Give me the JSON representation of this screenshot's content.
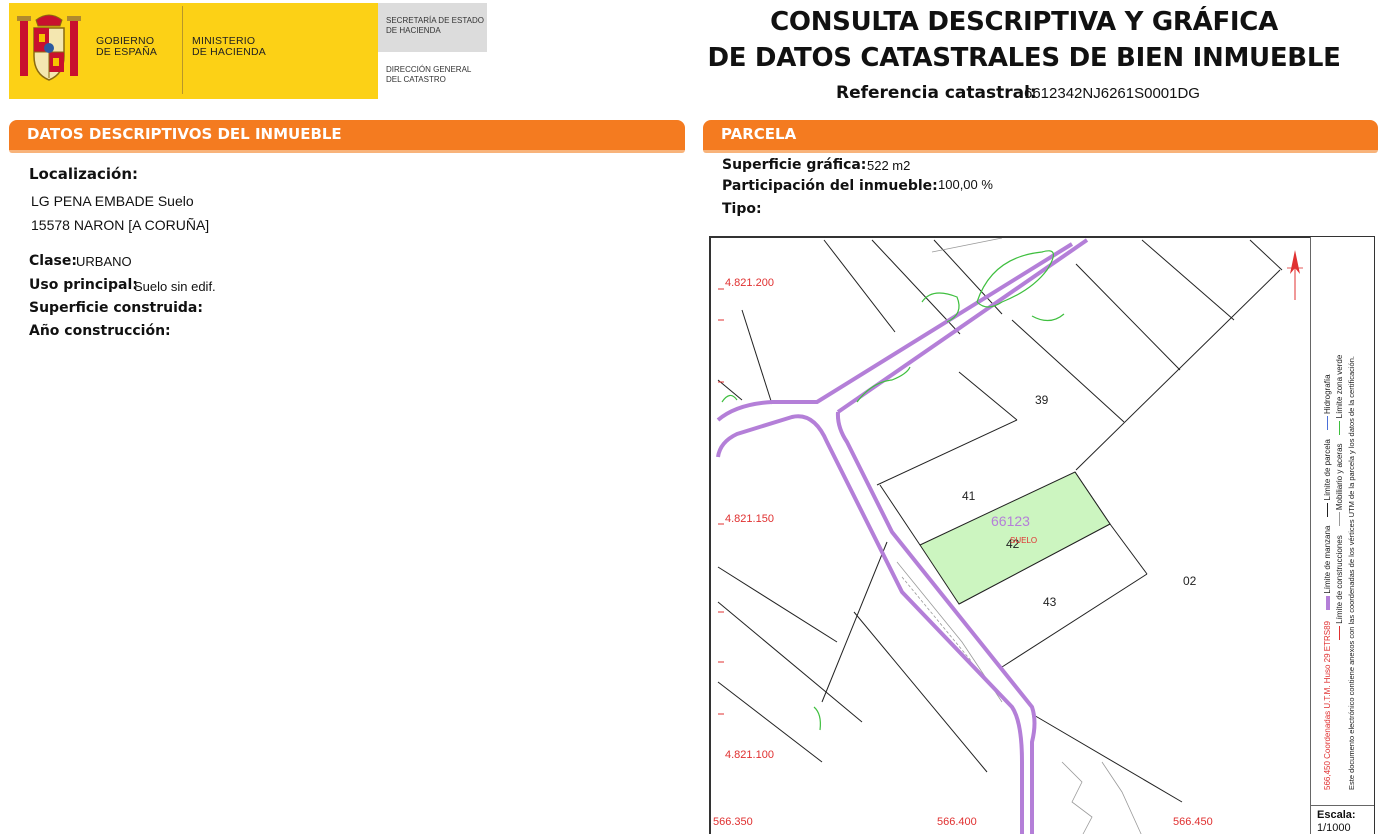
{
  "header": {
    "gov_line1": "GOBIERNO",
    "gov_line2": "DE ESPAÑA",
    "min_line1": "MINISTERIO",
    "min_line2": "DE HACIENDA",
    "sec_line1": "SECRETARÍA DE ESTADO",
    "sec_line2": "DE HACIENDA",
    "dir_line1": "DIRECCIÓN GENERAL",
    "dir_line2": "DEL CATASTRO",
    "title_line1": "CONSULTA DESCRIPTIVA Y GRÁFICA",
    "title_line2": "DE DATOS CATASTRALES DE BIEN INMUEBLE",
    "ref_label": "Referencia catastral:",
    "ref_value": "6612342NJ6261S0001DG"
  },
  "colors": {
    "accent_orange": "#f47b20",
    "logo_yellow": "#fcd116",
    "block_line": "#b47fd8",
    "parcel_fill": "#ccf5c0",
    "green_zone": "#3fbf3f",
    "coord_red": "#e03030"
  },
  "descriptive": {
    "heading_a": "DATOS DESCRIPTIVOS DEL ",
    "heading_b": "INMUEBLE",
    "loc_label": "Localización:",
    "loc_line1": "LG PENA EMBADE  Suelo",
    "loc_line2": "15578 NARON [A CORUÑA]",
    "clase_label": "Clase:",
    "clase_value": "URBANO",
    "uso_label": "Uso principal:",
    "uso_value": "Suelo sin edif.",
    "sup_label": "Superficie construida:",
    "anio_label": "Año construcción:"
  },
  "parcela": {
    "heading": "PARCELA",
    "sup_label": "Superficie gráfica:",
    "sup_value": "522 m2",
    "part_label": "Participación del inmueble:",
    "part_value": "100,00 %",
    "tipo_label": "Tipo:"
  },
  "map": {
    "y_labels": [
      "4.821.200",
      "4.821.150",
      "4.821.100"
    ],
    "x_labels": [
      "566.350",
      "566.400",
      "566.450"
    ],
    "parcel_labels": [
      "39",
      "41",
      "42",
      "43",
      "02"
    ],
    "block_code": "66123",
    "suelo_label": "SUELO",
    "legend_l1": "Límite de manzana",
    "legend_l2": "Límite de parcela",
    "legend_l3": "Hidrografía",
    "legend_l4": "Límite de construcciones",
    "legend_l5": "Mobiliario y aceras",
    "legend_l6": "Límite zona verde",
    "coords_note": "566,450 Coordenadas U.T.M. Huso 29 ETRS89",
    "doc_note": "Este documento electrónico contiene anexos con las coordenadas de los vértices UTM de la parcela y los datos de la certificación.",
    "scale_label": "Escala:",
    "scale_value": "1/1000",
    "north_icon": "north-arrow-icon"
  }
}
